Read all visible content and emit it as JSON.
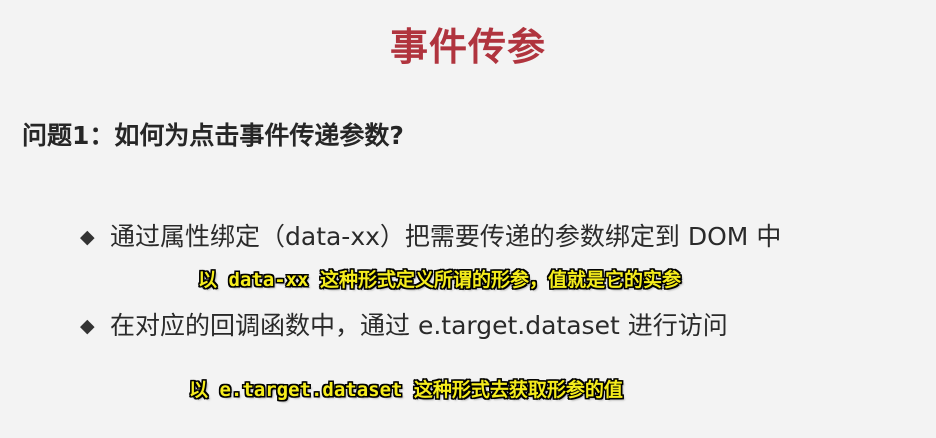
{
  "title": "事件传参",
  "question": "问题1：如何为点击事件传递参数?",
  "bullets": [
    {
      "icon": "diamond-bullet",
      "glyph": "◆",
      "text": "通过属性绑定（data-xx）把需要传递的参数绑定到 DOM 中"
    },
    {
      "icon": "diamond-bullet",
      "glyph": "◆",
      "text": "在对应的回调函数中，通过 e.target.dataset 进行访问"
    }
  ],
  "captions": [
    "以 data-xx 这种形式定义所谓的形参，值就是它的实参",
    "以 e.target.dataset 这种形式去获取形参的值"
  ],
  "colors": {
    "title": "#b0343e",
    "caption_text": "#f5ec1c",
    "caption_outline": "#000000",
    "background": "#f3f3f3"
  }
}
